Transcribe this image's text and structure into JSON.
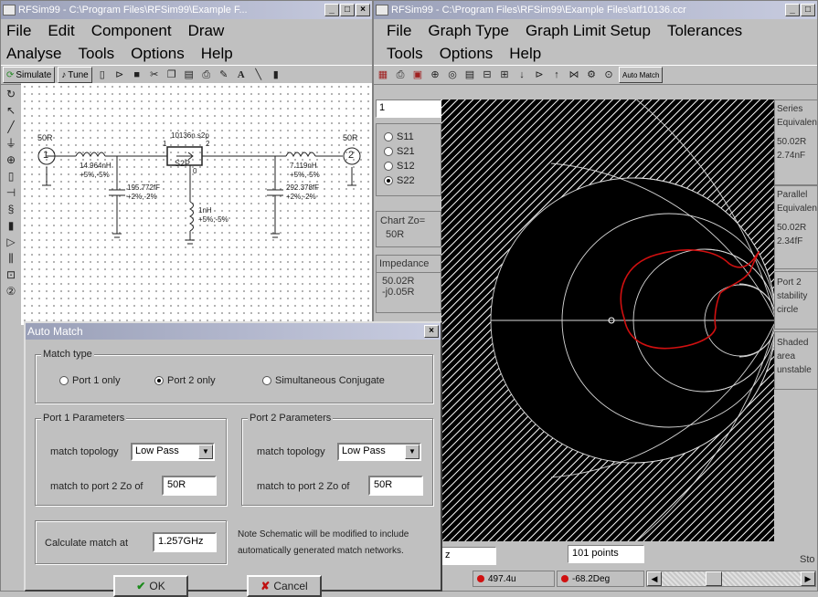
{
  "left_window": {
    "title": "RFSim99 - C:\\Program Files\\RFSim99\\Example F...",
    "menu_row1": [
      "File",
      "Edit",
      "Component",
      "Draw"
    ],
    "menu_row2": [
      "Analyse",
      "Tools",
      "Options",
      "Help"
    ],
    "toolbar": {
      "simulate": "Simulate",
      "tune": "Tune"
    },
    "schematic": {
      "port1": "1",
      "port1_imp": "50R",
      "port2": "2",
      "port2_imp": "50R",
      "l1": "14.964nH",
      "l1_tol": "+5%,-5%",
      "c1": "195.772fF",
      "c1_tol": "+2%,-2%",
      "s2p_file": "10136n.s2p",
      "s2p_label": "S2P",
      "s2p_pin1": "1",
      "s2p_pin2": "2",
      "s2p_pin0": "0",
      "l_gnd": "1nH",
      "l_gnd_tol": "+5%,-5%",
      "l2": "7.119nH",
      "l2_tol": "+5%,-5%",
      "c2": "292.378fF",
      "c2_tol": "+2%,-2%"
    }
  },
  "right_window": {
    "title": "RFSim99 - C:\\Program Files\\RFSim99\\Example Files\\atf10136.ccr",
    "menu_row1": [
      "File",
      "Graph Type",
      "Graph Limit Setup",
      "Tolerances"
    ],
    "menu_row2": [
      "Tools",
      "Options",
      "Help"
    ],
    "toolbar": {
      "auto_match": "Auto Match"
    },
    "left_panel": {
      "input_value": "1",
      "sparams": [
        "S11",
        "S21",
        "S12",
        "S22"
      ],
      "selected": "S22",
      "chart_zo_label": "Chart Zo=",
      "chart_zo_value": "50R",
      "impedance_label": "Impedance",
      "impedance_re": "50.02R",
      "impedance_im": "-j0.05R"
    },
    "right_panel": {
      "series_label1": "Series",
      "series_label2": "Equivalen",
      "series_r": "50.02R",
      "series_c": "2.74nF",
      "parallel_label1": "Parallel",
      "parallel_label2": "Equivalen",
      "parallel_r": "50.02R",
      "parallel_c": "2.34fF",
      "port_stab1": "Port 2",
      "port_stab2": "stability",
      "port_stab3": "circle",
      "shaded1": "Shaded",
      "shaded2": "area",
      "shaded3": "unstable",
      "stop": "Sto"
    },
    "bottom": {
      "freq_unit": "z",
      "points": "101 points",
      "mag": "497.4u",
      "phase": "-68.2Deg"
    }
  },
  "dialog": {
    "title": "Auto Match",
    "match_type_label": "Match type",
    "options": [
      "Port 1 only",
      "Port 2 only",
      "Simultaneous Conjugate"
    ],
    "selected": "Port 2 only",
    "port1": {
      "group": "Port 1 Parameters",
      "topology_label": "match topology",
      "topology": "Low Pass",
      "zo_label": "match to port 2 Zo of",
      "zo": "50R"
    },
    "port2": {
      "group": "Port 2 Parameters",
      "topology_label": "match topology",
      "topology": "Low Pass",
      "zo_label": "match to port 2 Zo of",
      "zo": "50R"
    },
    "calc_label": "Calculate match at",
    "calc_value": "1.257GHz",
    "note_line1": "Note Schematic will be modified to include",
    "note_line2": "automatically generated match networks.",
    "ok": "OK",
    "cancel": "Cancel"
  }
}
